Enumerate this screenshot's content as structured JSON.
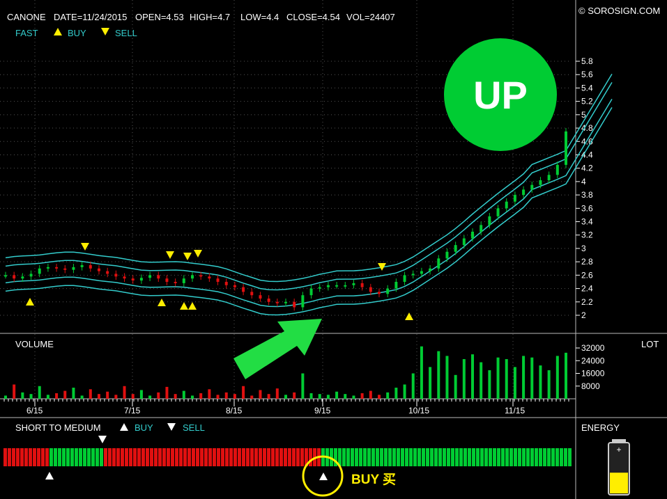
{
  "header": {
    "symbol": "CANONE",
    "date": "DATE=11/24/2015",
    "open": "OPEN=4.53",
    "high": "HIGH=4.7",
    "low": "LOW=4.4",
    "close": "CLOSE=4.54",
    "vol": "VOL=24407",
    "copyright": "© SOROSIGN.COM"
  },
  "legend": {
    "fast": "FAST",
    "buy": "BUY",
    "sell": "SELL"
  },
  "badge": {
    "text": "UP",
    "color": "#00cc33"
  },
  "volume_panel": {
    "label": "VOLUME",
    "unit": "LOT",
    "ticks": [
      "32000",
      "24000",
      "16000",
      "8000"
    ]
  },
  "indicator_panel": {
    "label": "SHORT TO MEDIUM",
    "buy": "BUY",
    "sell": "SELL"
  },
  "energy_panel": {
    "label": "ENERGY",
    "level": 0.42
  },
  "buy_callout": {
    "text": "BUY 买"
  },
  "colors": {
    "up": "#00cc33",
    "down": "#e01010",
    "channel": "#33cccc",
    "signal": "#ffee00",
    "grid": "#555555"
  },
  "chart_data": {
    "type": "candlestick",
    "price_axis": {
      "range": [
        1.85,
        5.95
      ],
      "ticks": [
        "5.8",
        "5.6",
        "5.4",
        "5.2",
        "5",
        "4.8",
        "4.6",
        "4.4",
        "4.2",
        "4",
        "3.8",
        "3.6",
        "3.4",
        "3.2",
        "3",
        "2.8",
        "2.6",
        "2.4",
        "2.2",
        "2"
      ]
    },
    "date_ticks": [
      "6/15",
      "7/15",
      "8/15",
      "9/15",
      "10/15",
      "11/15"
    ],
    "volume_axis": {
      "range": [
        0,
        38000
      ]
    },
    "price_series": [
      2.6,
      2.55,
      2.58,
      2.62,
      2.7,
      2.72,
      2.7,
      2.68,
      2.72,
      2.75,
      2.7,
      2.66,
      2.62,
      2.58,
      2.55,
      2.52,
      2.56,
      2.6,
      2.55,
      2.5,
      2.48,
      2.55,
      2.6,
      2.58,
      2.55,
      2.5,
      2.45,
      2.42,
      2.35,
      2.3,
      2.25,
      2.2,
      2.18,
      2.2,
      2.12,
      2.3,
      2.4,
      2.42,
      2.45,
      2.45,
      2.45,
      2.48,
      2.42,
      2.35,
      2.32,
      2.4,
      2.5,
      2.6,
      2.62,
      2.66,
      2.7,
      2.85,
      2.95,
      3.05,
      3.15,
      3.25,
      3.35,
      3.48,
      3.6,
      3.7,
      3.8,
      3.88,
      3.95,
      4.02,
      4.1,
      4.25,
      4.75
    ],
    "volume_series": [
      2000,
      9000,
      4000,
      3000,
      8000,
      2500,
      3500,
      5000,
      7000,
      2000,
      6000,
      3000,
      4500,
      2500,
      8000,
      3000,
      5500,
      2000,
      4000,
      7500,
      3000,
      5000,
      2000,
      3500,
      6000,
      2500,
      4000,
      3000,
      8000,
      2000,
      5500,
      3000,
      6500,
      2500,
      4000,
      16000,
      3500,
      3000,
      2500,
      4500,
      3000,
      2000,
      3500,
      5000,
      2500,
      4000,
      7000,
      9000,
      16000,
      33000,
      20000,
      30000,
      27000,
      15000,
      25000,
      28000,
      23000,
      18000,
      26000,
      25000,
      20000,
      27000,
      26000,
      21000,
      18000,
      27000,
      29000
    ],
    "signals": {
      "buy": [
        "6/15",
        "7/15 (1)",
        "7/15 (2)",
        "7/15 (3)",
        "9/15 (1)",
        "10/15"
      ],
      "sell": [
        "6/15",
        "7/15 (1)",
        "7/15 (2)",
        "7/15 (3)",
        "9/15"
      ]
    },
    "indicator": {
      "segments": [
        {
          "signal": "sell",
          "bars": 11
        },
        {
          "signal": "buy",
          "bars": 13
        },
        {
          "signal": "sell",
          "bars": 52
        },
        {
          "signal": "buy",
          "bars": 60
        }
      ]
    }
  }
}
